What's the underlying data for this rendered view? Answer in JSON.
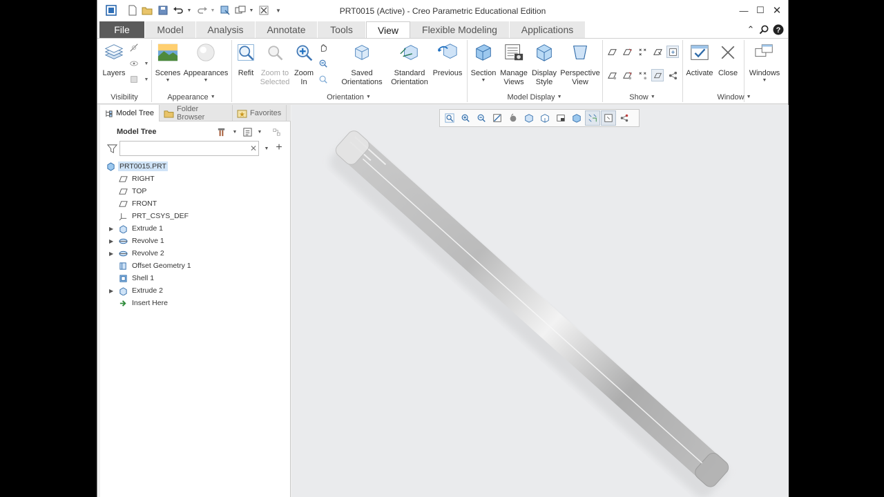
{
  "window": {
    "title": "PRT0015 (Active) - Creo Parametric Educational Edition",
    "controls": [
      "minimize-icon",
      "maximize-icon",
      "close-icon"
    ]
  },
  "quick_access": [
    "app-icon",
    "new-icon",
    "open-icon",
    "save-icon",
    "undo-icon",
    "redo-icon",
    "regenerate-icon",
    "windows-icon",
    "close-window-icon",
    "customize-icon"
  ],
  "tabs": [
    {
      "label": "File"
    },
    {
      "label": "Model"
    },
    {
      "label": "Analysis"
    },
    {
      "label": "Annotate"
    },
    {
      "label": "Tools"
    },
    {
      "label": "View"
    },
    {
      "label": "Flexible Modeling"
    },
    {
      "label": "Applications"
    }
  ],
  "active_tab": "View",
  "ribbon": {
    "layers": "Layers",
    "scenes": "Scenes",
    "appearances": "Appearances",
    "refit": "Refit",
    "zoom_selected": "Zoom to Selected",
    "zoom_in": "Zoom In",
    "saved_orientations": "Saved Orientations",
    "standard_orientation": "Standard Orientation",
    "previous": "Previous",
    "section": "Section",
    "manage_views": "Manage Views",
    "display_style": "Display Style",
    "perspective_view": "Perspective View",
    "activate": "Activate",
    "close": "Close",
    "windows": "Windows",
    "groups": {
      "visibility": "Visibility",
      "appearance": "Appearance",
      "orientation": "Orientation",
      "model_display": "Model Display",
      "show": "Show",
      "window": "Window"
    }
  },
  "panel": {
    "tabs": [
      "Model Tree",
      "Folder Browser",
      "Favorites"
    ],
    "header": "Model Tree",
    "search_value": "",
    "tree": [
      {
        "label": "PRT0015.PRT",
        "icon": "part-icon",
        "expandable": false,
        "selected": true,
        "indent": 0
      },
      {
        "label": "RIGHT",
        "icon": "datum-plane-icon",
        "expandable": false,
        "selected": false,
        "indent": 1
      },
      {
        "label": "TOP",
        "icon": "datum-plane-icon",
        "expandable": false,
        "selected": false,
        "indent": 1
      },
      {
        "label": "FRONT",
        "icon": "datum-plane-icon",
        "expandable": false,
        "selected": false,
        "indent": 1
      },
      {
        "label": "PRT_CSYS_DEF",
        "icon": "csys-icon",
        "expandable": false,
        "selected": false,
        "indent": 1
      },
      {
        "label": "Extrude 1",
        "icon": "extrude-icon",
        "expandable": true,
        "selected": false,
        "indent": 1
      },
      {
        "label": "Revolve 1",
        "icon": "revolve-icon",
        "expandable": true,
        "selected": false,
        "indent": 1
      },
      {
        "label": "Revolve 2",
        "icon": "revolve-icon",
        "expandable": true,
        "selected": false,
        "indent": 1
      },
      {
        "label": "Offset Geometry 1",
        "icon": "offset-icon",
        "expandable": false,
        "selected": false,
        "indent": 1
      },
      {
        "label": "Shell 1",
        "icon": "shell-icon",
        "expandable": false,
        "selected": false,
        "indent": 1
      },
      {
        "label": "Extrude 2",
        "icon": "extrude-icon",
        "expandable": true,
        "selected": false,
        "indent": 1
      },
      {
        "label": "Insert Here",
        "icon": "insert-arrow-icon",
        "expandable": false,
        "selected": false,
        "indent": 1
      }
    ]
  },
  "view_toolbar": [
    "refit-icon",
    "zoom-in-icon",
    "zoom-out-icon",
    "repaint-icon",
    "shading-icon",
    "saved-orientations-icon",
    "named-views-icon",
    "display-style-icon",
    "perspective-icon",
    "spin-center-icon",
    "datum-display-icon",
    "annotation-display-icon"
  ],
  "colors": {
    "accent": "#1e6fc0",
    "file_tab": "#5b5b5b",
    "selection": "#cfe3f7",
    "viewport": "#eaebed"
  }
}
